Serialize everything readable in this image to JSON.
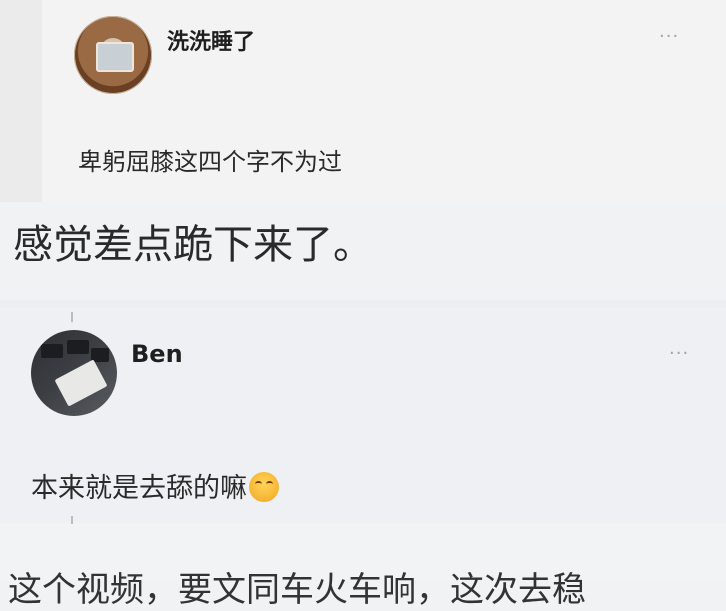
{
  "post1": {
    "username": "洗洗睡了",
    "more": "···",
    "text": "卑躬屈膝这四个字不为过"
  },
  "caption": "感觉差点跪下来了。",
  "post2": {
    "username": "Ben",
    "more": "···",
    "text": "本来就是去舔的嘛",
    "emoji": "face-with-tears-of-joy-icon"
  },
  "bottom_partial_text": "这个视频，要文同车火车响，这次去稳"
}
